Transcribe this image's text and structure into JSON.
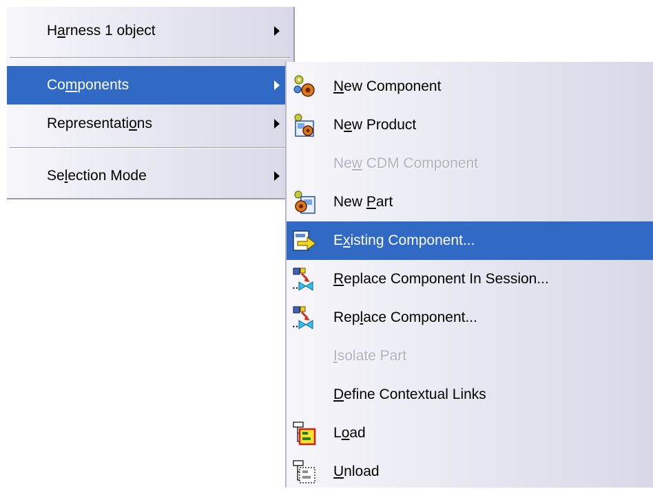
{
  "main_menu": {
    "items": [
      {
        "label_pre": "H",
        "hotkey": "a",
        "label_post": "rness 1 object",
        "has_submenu": true
      },
      {
        "label_pre": "Co",
        "hotkey": "m",
        "label_post": "ponents",
        "has_submenu": true,
        "selected": true
      },
      {
        "label_pre": "Representati",
        "hotkey": "o",
        "label_post": "ns",
        "has_submenu": true
      },
      {
        "label_pre": "Se",
        "hotkey": "l",
        "label_post": "ection Mode",
        "has_submenu": true
      }
    ]
  },
  "submenu": {
    "items": [
      {
        "label_pre": "",
        "hotkey": "N",
        "label_post": "ew Component",
        "icon": "new-component-gears-icon",
        "enabled": true
      },
      {
        "label_pre": "N",
        "hotkey": "e",
        "label_post": "w Product",
        "icon": "new-product-icon",
        "enabled": true
      },
      {
        "label_pre": "Ne",
        "hotkey": "w",
        "label_post": " CDM Component",
        "icon": "",
        "enabled": false
      },
      {
        "label_pre": "New ",
        "hotkey": "P",
        "label_post": "art",
        "icon": "new-part-icon",
        "enabled": true
      },
      {
        "label_pre": "E",
        "hotkey": "x",
        "label_post": "isting Component...",
        "icon": "existing-component-arrow-icon",
        "enabled": true,
        "selected": true
      },
      {
        "label_pre": "",
        "hotkey": "R",
        "label_post": "eplace Component In Session...",
        "icon": "replace-component-in-session-icon",
        "enabled": true
      },
      {
        "label_pre": "Rep",
        "hotkey": "l",
        "label_post": "ace Component...",
        "icon": "replace-component-icon",
        "enabled": true
      },
      {
        "label_pre": "",
        "hotkey": "I",
        "label_post": "solate Part",
        "icon": "",
        "enabled": false
      },
      {
        "label_pre": "",
        "hotkey": "D",
        "label_post": "efine Contextual Links",
        "icon": "",
        "enabled": true
      },
      {
        "label_pre": "L",
        "hotkey": "o",
        "label_post": "ad",
        "icon": "load-tree-icon",
        "enabled": true
      },
      {
        "label_pre": "",
        "hotkey": "U",
        "label_post": "nload",
        "icon": "unload-tree-icon",
        "enabled": true
      }
    ]
  },
  "colors": {
    "selection": "#316ac5",
    "menu_gradient_start": "#f6f6fa",
    "menu_gradient_end": "#d8d8e8",
    "disabled_text": "#b0b0c0"
  }
}
